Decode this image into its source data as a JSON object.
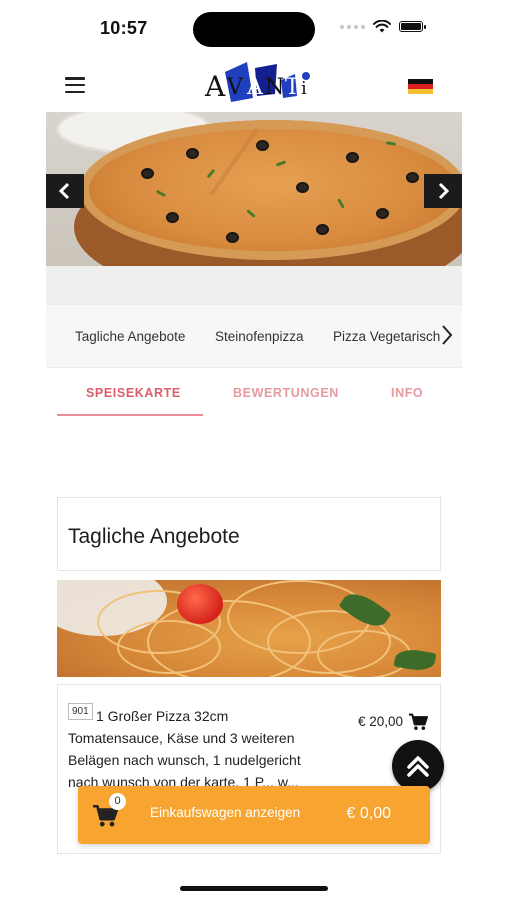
{
  "status_bar": {
    "time": "10:57"
  },
  "header": {
    "logo_text": "AVANTI",
    "language_flag": "germany-flag-icon"
  },
  "hero": {
    "prev_icon": "chevron-left-icon",
    "next_icon": "chevron-right-icon"
  },
  "categories": {
    "items": [
      "Tagliche Angebote",
      "Steinofenpizza",
      "Pizza Vegetarisch"
    ],
    "next_icon": "chevron-right-icon"
  },
  "tabs": {
    "items": [
      "SPEISEKARTE",
      "BEWERTUNGEN",
      "INFO"
    ],
    "active": "SPEISEKARTE"
  },
  "section": {
    "title": "Tagliche Angebote"
  },
  "menu_item": {
    "number": "901",
    "description": "1 Großer Pizza 32cm Tomatensauce, Käse und 3 weiteren Belägen nach wunsch, 1 nudelgericht nach wunsch von der karte, 1 P... w...",
    "price": "€ 20,00",
    "cart_icon": "cart-icon"
  },
  "cart_bar": {
    "count": "0",
    "label": "Einkaufswagen anzeigen",
    "total": "€ 0,00"
  },
  "colors": {
    "accent_orange": "#f7a530",
    "tab_active": "#dd5e69",
    "tab_inactive": "#e79aa0"
  }
}
